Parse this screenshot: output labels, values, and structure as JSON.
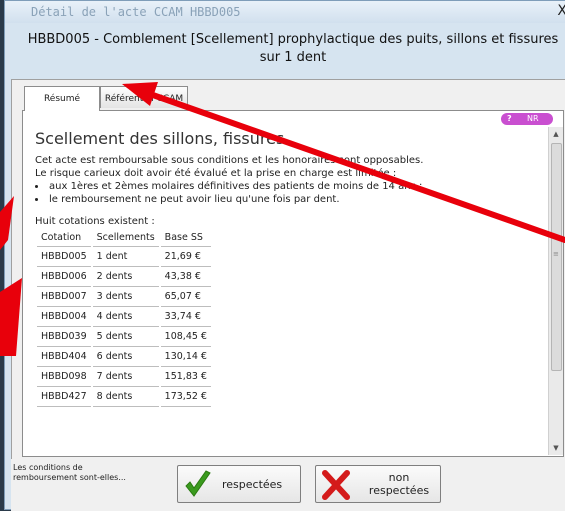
{
  "window": {
    "title": "Détail de l'acte CCAM HBBD005",
    "close_glyph": "X"
  },
  "header": {
    "text": "HBBD005 - Comblement [Scellement] prophylactique des puits, sillons et fissures sur 1 dent"
  },
  "tabs": [
    {
      "label": "Résumé",
      "active": true
    },
    {
      "label": "Référentiel CCAM",
      "active": false
    }
  ],
  "badge": {
    "q": "?",
    "text": "NR",
    "color": "#c94fd0"
  },
  "summary": {
    "title": "Scellement des sillons, fissures",
    "p1": "Cet acte est remboursable sous conditions et les honoraires sont opposables.",
    "p2": "Le risque carieux doit avoir été évalué et la prise en charge est limitée :",
    "bullets": [
      "aux 1ères et 2èmes molaires définitives des patients de moins de 14 ans ;",
      "le remboursement ne peut avoir lieu qu'une fois par dent."
    ],
    "sub": "Huit cotations existent :"
  },
  "table": {
    "headers": [
      "Cotation",
      "Scellements",
      "Base SS"
    ],
    "rows": [
      [
        "HBBD005",
        "1 dent",
        "21,69 €"
      ],
      [
        "HBBD006",
        "2 dents",
        "43,38 €"
      ],
      [
        "HBBD007",
        "3 dents",
        "65,07 €"
      ],
      [
        "HBBD004",
        "4 dents",
        "33,74 €"
      ],
      [
        "HBBD039",
        "5 dents",
        "108,45 €"
      ],
      [
        "HBBD404",
        "6 dents",
        "130,14 €"
      ],
      [
        "HBBD098",
        "7 dents",
        "151,83 €"
      ],
      [
        "HBBD427",
        "8 dents",
        "173,52 €"
      ]
    ]
  },
  "footer": {
    "question": "Les conditions de remboursement sont-elles...",
    "btn_yes": "respectées",
    "btn_no_1": "non",
    "btn_no_2": "respectées"
  },
  "scrollbar": {
    "grip": "≡",
    "up": "▲",
    "down": "▼"
  },
  "colors": {
    "annotation_arrow": "#e8000b",
    "check": "#3a9a1e",
    "cross": "#d41a1a"
  }
}
